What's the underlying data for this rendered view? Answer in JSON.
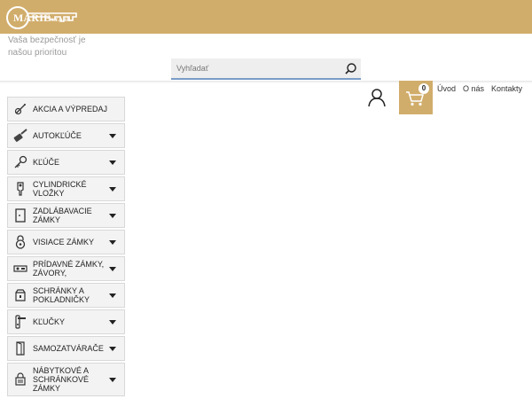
{
  "header": {
    "logo_text": "MARIE",
    "logo_domain": "s.r.o.sk",
    "tagline": "Vaša bezpečnosť je našou prioritou"
  },
  "search": {
    "placeholder": "Vyhľadať"
  },
  "cart": {
    "count": "0"
  },
  "nav": [
    {
      "label": "Úvod"
    },
    {
      "label": "O nás"
    },
    {
      "label": "Kontakty"
    }
  ],
  "categories": [
    {
      "label": "AKCIA A VÝPREDAJ",
      "icon": "tag-icon",
      "has_submenu": false
    },
    {
      "label": "AUTOKĽÚČE",
      "icon": "car-key-icon",
      "has_submenu": true
    },
    {
      "label": "KĽÚČE",
      "icon": "key-icon",
      "has_submenu": true
    },
    {
      "label": "CYLINDRICKÉ VLOŽKY",
      "icon": "cylinder-icon",
      "has_submenu": true
    },
    {
      "label": "ZADLÁBAVACIE ZÁMKY",
      "icon": "door-icon",
      "has_submenu": true
    },
    {
      "label": "VISIACE ZÁMKY",
      "icon": "padlock-icon",
      "has_submenu": true
    },
    {
      "label": "PRÍDAVNÉ ZÁMKY, ZÁVORY,",
      "icon": "bolt-lock-icon",
      "has_submenu": true
    },
    {
      "label": "SCHRÁNKY A POKLADNIČKY",
      "icon": "safe-icon",
      "has_submenu": true
    },
    {
      "label": "KĽUČKY",
      "icon": "handle-icon",
      "has_submenu": true
    },
    {
      "label": "SAMOZATVÁRAČE",
      "icon": "door-closer-icon",
      "has_submenu": true
    },
    {
      "label": "NÁBYTKOVÉ A SCHRÁNKOVÉ ZÁMKY",
      "icon": "furniture-lock-icon",
      "has_submenu": true
    }
  ]
}
